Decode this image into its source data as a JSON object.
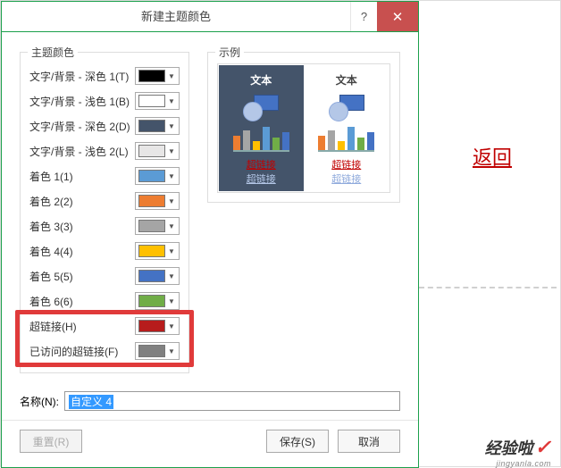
{
  "dialog": {
    "title": "新建主题颜色",
    "help": "?",
    "close": "✕",
    "group_theme": "主题颜色",
    "group_example": "示例",
    "rows": [
      {
        "label": "文字/背景 - 深色 1(T)",
        "color": "#000000"
      },
      {
        "label": "文字/背景 - 浅色 1(B)",
        "color": "#ffffff"
      },
      {
        "label": "文字/背景 - 深色 2(D)",
        "color": "#44546a"
      },
      {
        "label": "文字/背景 - 浅色 2(L)",
        "color": "#e7e6e6"
      },
      {
        "label": "着色 1(1)",
        "color": "#5b9bd5"
      },
      {
        "label": "着色 2(2)",
        "color": "#ed7d31"
      },
      {
        "label": "着色 3(3)",
        "color": "#a5a5a5"
      },
      {
        "label": "着色 4(4)",
        "color": "#ffc000"
      },
      {
        "label": "着色 5(5)",
        "color": "#4472c4"
      },
      {
        "label": "着色 6(6)",
        "color": "#70ad47"
      },
      {
        "label": "超链接(H)",
        "color": "#b71c1c"
      },
      {
        "label": "已访问的超链接(F)",
        "color": "#808080"
      }
    ],
    "example": {
      "text_label": "文本",
      "hyperlink": "超链接",
      "hyperlink_visited": "超链接"
    },
    "name_label": "名称(N):",
    "name_value": "自定义 4",
    "reset": "重置(R)",
    "save": "保存(S)",
    "cancel": "取消"
  },
  "outside": {
    "return_link": "返回",
    "watermark_main": "经验啦",
    "watermark_sub": "jingyanla.com"
  }
}
